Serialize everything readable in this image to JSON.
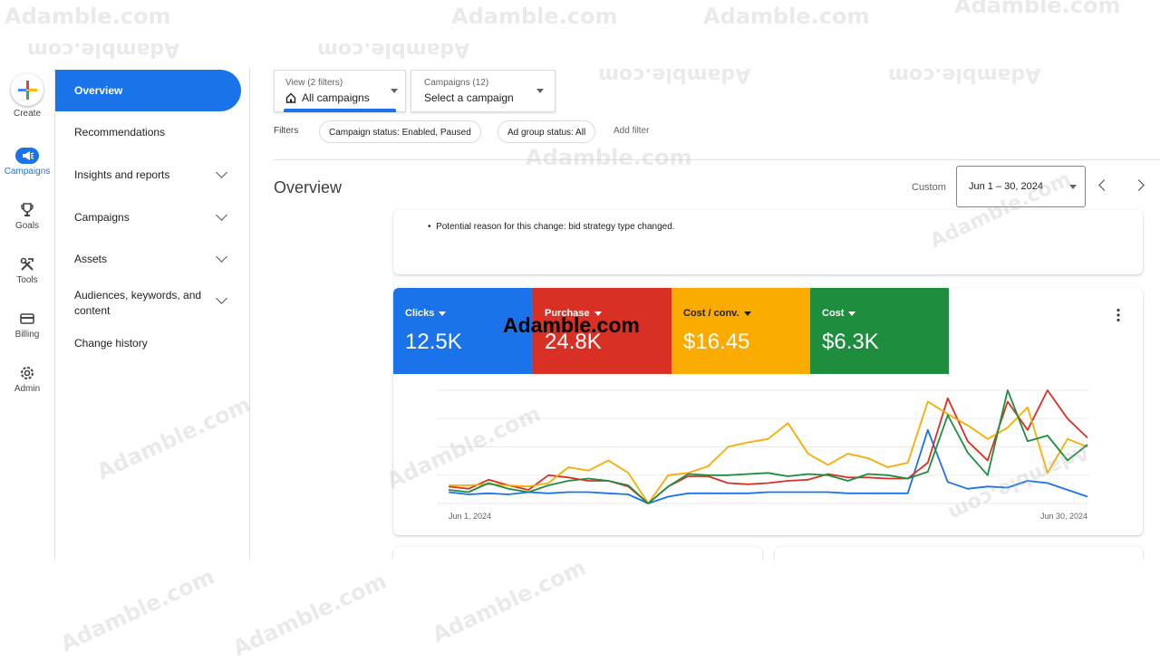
{
  "rail": {
    "create": "Create",
    "campaigns": "Campaigns",
    "goals": "Goals",
    "tools": "Tools",
    "billing": "Billing",
    "admin": "Admin"
  },
  "nav": {
    "overview": "Overview",
    "recommendations": "Recommendations",
    "insights": "Insights and reports",
    "campaigns": "Campaigns",
    "assets": "Assets",
    "audiences": "Audiences, keywords, and content",
    "change_history": "Change history"
  },
  "header": {
    "view_small": "View (2 filters)",
    "view_main": "All campaigns",
    "campaigns_small": "Campaigns (12)",
    "campaigns_main": "Select a campaign"
  },
  "filters": {
    "label": "Filters",
    "chip1": "Campaign status: Enabled, Paused",
    "chip2": "Ad group status: All",
    "add": "Add filter"
  },
  "page": {
    "title": "Overview",
    "range_label": "Custom",
    "date_range": "Jun 1 – 30, 2024"
  },
  "insight": {
    "bullet": "Potential reason for this change: bid strategy type changed."
  },
  "metrics": [
    {
      "label": "Clicks",
      "value": "12.5K",
      "color": "#1a73e8"
    },
    {
      "label": "Purchase",
      "value": "24.8K",
      "color": "#d93025"
    },
    {
      "label": "Cost / conv.",
      "value": "$16.45",
      "color": "#f9ab00"
    },
    {
      "label": "Cost",
      "value": "$6.3K",
      "color": "#1e8e3e"
    }
  ],
  "watermark": {
    "text": "Adamble.com"
  },
  "chart_data": {
    "type": "line",
    "x_start_label": "Jun 1, 2024",
    "x_end_label": "Jun 30, 2024",
    "series": [
      {
        "name": "Clicks",
        "color": "#1a73e8",
        "values": [
          0.1,
          0.08,
          0.09,
          0.08,
          0.1,
          0.09,
          0.1,
          0.1,
          0.09,
          0.08,
          0.0,
          0.06,
          0.09,
          0.09,
          0.09,
          0.09,
          0.1,
          0.1,
          0.1,
          0.1,
          0.09,
          0.09,
          0.09,
          0.09,
          0.65,
          0.19,
          0.13,
          0.15,
          0.14,
          0.2,
          0.18,
          0.12,
          0.06
        ]
      },
      {
        "name": "Purchase",
        "color": "#d93025",
        "values": [
          0.15,
          0.13,
          0.21,
          0.16,
          0.12,
          0.25,
          0.23,
          0.2,
          0.2,
          0.15,
          0.0,
          0.15,
          0.24,
          0.24,
          0.18,
          0.17,
          0.18,
          0.2,
          0.21,
          0.26,
          0.23,
          0.23,
          0.22,
          0.22,
          0.36,
          0.93,
          0.55,
          0.38,
          0.9,
          0.65,
          1.0,
          0.75,
          0.58
        ]
      },
      {
        "name": "Cost / conv.",
        "color": "#f9ab00",
        "values": [
          0.16,
          0.16,
          0.17,
          0.16,
          0.15,
          0.18,
          0.32,
          0.29,
          0.38,
          0.27,
          0.0,
          0.25,
          0.27,
          0.33,
          0.5,
          0.54,
          0.57,
          0.71,
          0.44,
          0.34,
          0.44,
          0.4,
          0.32,
          0.36,
          0.9,
          0.79,
          0.69,
          0.57,
          0.67,
          0.85,
          0.27,
          0.57,
          0.5
        ]
      },
      {
        "name": "Cost",
        "color": "#1e8e3e",
        "values": [
          0.12,
          0.1,
          0.18,
          0.13,
          0.1,
          0.16,
          0.2,
          0.22,
          0.2,
          0.16,
          0.0,
          0.15,
          0.26,
          0.25,
          0.25,
          0.26,
          0.27,
          0.24,
          0.26,
          0.25,
          0.2,
          0.26,
          0.25,
          0.22,
          0.28,
          0.78,
          0.45,
          0.25,
          1.0,
          0.55,
          0.6,
          0.38,
          0.52
        ]
      }
    ]
  }
}
